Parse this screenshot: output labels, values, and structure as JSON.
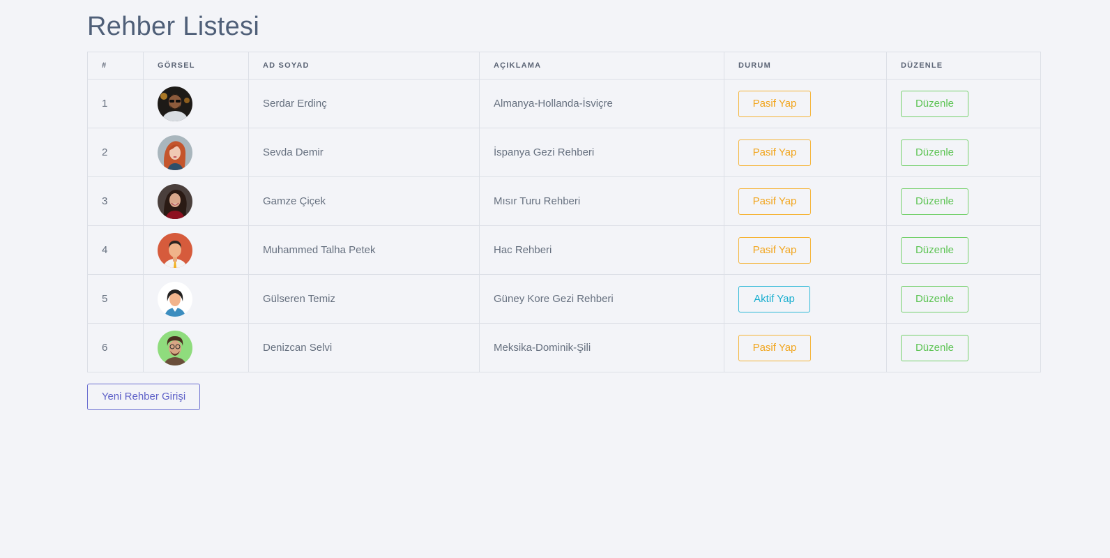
{
  "page_title": "Rehber Listesi",
  "table": {
    "headers": [
      "#",
      "GÖRSEL",
      "AD SOYAD",
      "AÇIKLAMA",
      "DURUM",
      "DÜZENLE"
    ],
    "rows": [
      {
        "id": "1",
        "name": "Serdar Erdinç",
        "description": "Almanya-Hollanda-İsviçre",
        "status_action": "Pasif Yap",
        "status_type": "warning",
        "edit_label": "Düzenle",
        "avatar": "man-sunglasses"
      },
      {
        "id": "2",
        "name": "Sevda Demir",
        "description": "İspanya Gezi Rehberi",
        "status_action": "Pasif Yap",
        "status_type": "warning",
        "edit_label": "Düzenle",
        "avatar": "woman-red-hair"
      },
      {
        "id": "3",
        "name": "Gamze Çiçek",
        "description": "Mısır Turu Rehberi",
        "status_action": "Pasif Yap",
        "status_type": "warning",
        "edit_label": "Düzenle",
        "avatar": "woman-smiling"
      },
      {
        "id": "4",
        "name": "Muhammed Talha Petek",
        "description": "Hac Rehberi",
        "status_action": "Pasif Yap",
        "status_type": "warning",
        "edit_label": "Düzenle",
        "avatar": "man-illustration"
      },
      {
        "id": "5",
        "name": "Gülseren Temiz",
        "description": "Güney Kore Gezi Rehberi",
        "status_action": "Aktif Yap",
        "status_type": "info",
        "edit_label": "Düzenle",
        "avatar": "woman-illustration"
      },
      {
        "id": "6",
        "name": "Denizcan Selvi",
        "description": "Meksika-Dominik-Şili",
        "status_action": "Pasif Yap",
        "status_type": "warning",
        "edit_label": "Düzenle",
        "avatar": "man-curly-hair"
      }
    ]
  },
  "new_button_label": "Yeni Rehber Girişi",
  "colors": {
    "background": "#f3f4f8",
    "title": "#4f5f78",
    "warning": "#f1a51d",
    "info": "#19aecf",
    "success": "#5ec455",
    "primary": "#5f62c8"
  }
}
